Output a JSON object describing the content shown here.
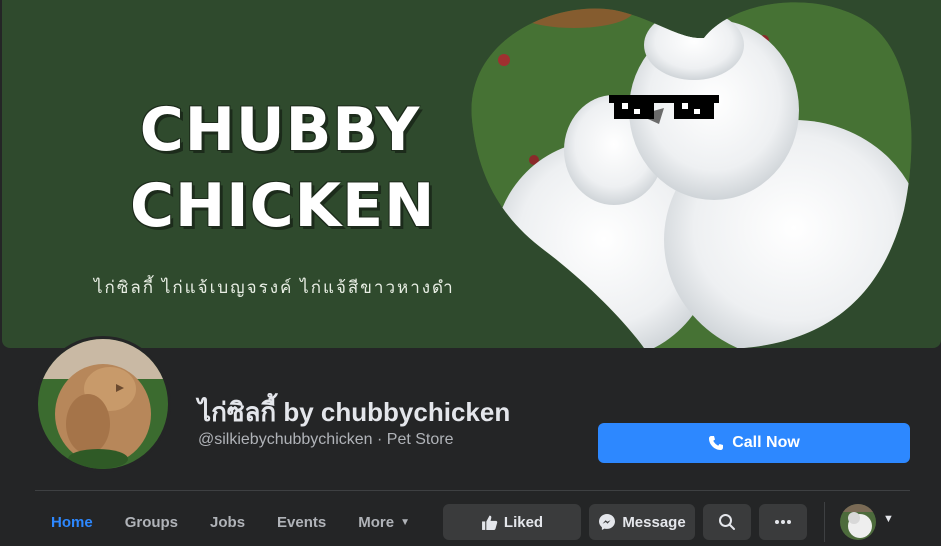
{
  "cover": {
    "title_line1": "CHUBBY",
    "title_line2": "CHICKEN",
    "subtitle": "ไก่ซิลกี้ ไก่แจ้เบญจรงค์ ไก่แจ้สีขาวหางดำ"
  },
  "profile": {
    "name": "ไก่ซิลกี้ by chubbychicken",
    "meta": "@silkiebychubbychicken · Pet Store"
  },
  "call_now": {
    "label": "Call Now",
    "icon": "phone-icon"
  },
  "tabs": [
    {
      "label": "Home",
      "active": true
    },
    {
      "label": "Groups"
    },
    {
      "label": "Jobs"
    },
    {
      "label": "Events"
    },
    {
      "label": "More"
    }
  ],
  "actions": {
    "liked": "Liked",
    "message": "Message"
  },
  "colors": {
    "accent": "#2d88ff",
    "cover_green": "#2f4a2d",
    "background": "#242526"
  }
}
